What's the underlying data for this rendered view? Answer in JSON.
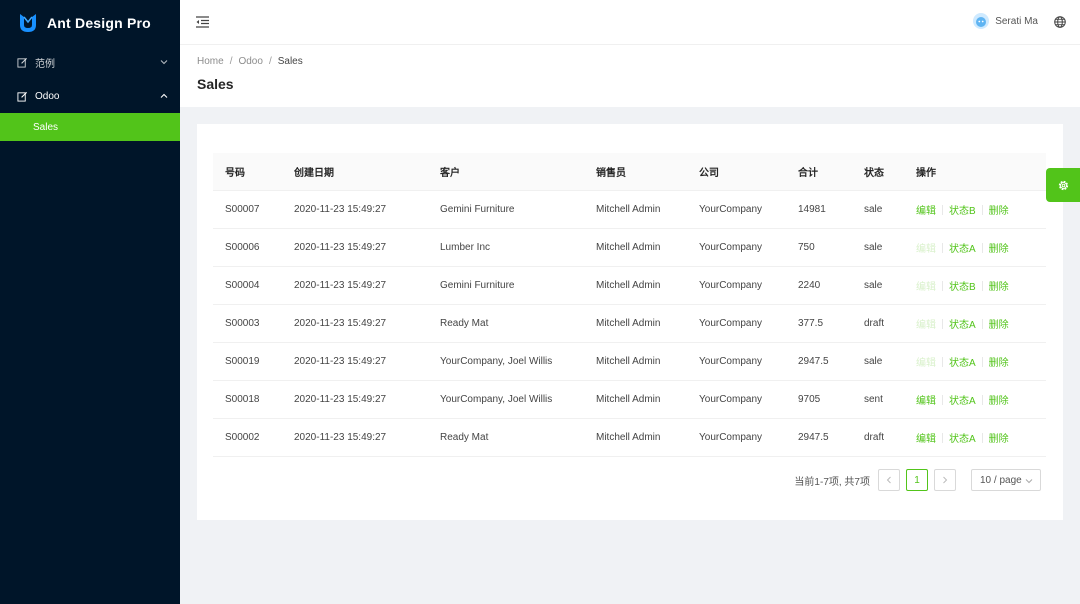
{
  "app": {
    "title": "Ant Design Pro"
  },
  "sidebar": {
    "menus": [
      {
        "label": "范例",
        "icon": "edit-icon",
        "expanded": false
      },
      {
        "label": "Odoo",
        "icon": "edit-icon",
        "expanded": true
      }
    ],
    "submenu": {
      "label": "Sales",
      "selected": true
    }
  },
  "header": {
    "user_name": "Serati Ma"
  },
  "breadcrumb": {
    "items": [
      "Home",
      "Odoo",
      "Sales"
    ]
  },
  "page": {
    "title": "Sales"
  },
  "table": {
    "columns": [
      "号码",
      "创建日期",
      "客户",
      "销售员",
      "公司",
      "合计",
      "状态",
      "操作"
    ],
    "rows": [
      {
        "id": "S00007",
        "date": "2020-11-23 15:49:27",
        "customer": "Gemini Furniture",
        "sales": "Mitchell Admin",
        "company": "YourCompany",
        "total": "14981",
        "state": "sale",
        "edit": "编辑",
        "edit_enabled": true,
        "toggle": "状态B",
        "delete": "删除"
      },
      {
        "id": "S00006",
        "date": "2020-11-23 15:49:27",
        "customer": "Lumber Inc",
        "sales": "Mitchell Admin",
        "company": "YourCompany",
        "total": "750",
        "state": "sale",
        "edit": "编辑",
        "edit_enabled": false,
        "toggle": "状态A",
        "delete": "删除"
      },
      {
        "id": "S00004",
        "date": "2020-11-23 15:49:27",
        "customer": "Gemini Furniture",
        "sales": "Mitchell Admin",
        "company": "YourCompany",
        "total": "2240",
        "state": "sale",
        "edit": "编辑",
        "edit_enabled": false,
        "toggle": "状态B",
        "delete": "删除"
      },
      {
        "id": "S00003",
        "date": "2020-11-23 15:49:27",
        "customer": "Ready Mat",
        "sales": "Mitchell Admin",
        "company": "YourCompany",
        "total": "377.5",
        "state": "draft",
        "edit": "编辑",
        "edit_enabled": false,
        "toggle": "状态A",
        "delete": "删除"
      },
      {
        "id": "S00019",
        "date": "2020-11-23 15:49:27",
        "customer": "YourCompany, Joel Willis",
        "sales": "Mitchell Admin",
        "company": "YourCompany",
        "total": "2947.5",
        "state": "sale",
        "edit": "编辑",
        "edit_enabled": false,
        "toggle": "状态A",
        "delete": "删除"
      },
      {
        "id": "S00018",
        "date": "2020-11-23 15:49:27",
        "customer": "YourCompany, Joel Willis",
        "sales": "Mitchell Admin",
        "company": "YourCompany",
        "total": "9705",
        "state": "sent",
        "edit": "编辑",
        "edit_enabled": true,
        "toggle": "状态A",
        "delete": "删除"
      },
      {
        "id": "S00002",
        "date": "2020-11-23 15:49:27",
        "customer": "Ready Mat",
        "sales": "Mitchell Admin",
        "company": "YourCompany",
        "total": "2947.5",
        "state": "draft",
        "edit": "编辑",
        "edit_enabled": true,
        "toggle": "状态A",
        "delete": "删除"
      }
    ]
  },
  "pagination": {
    "total_text": "当前1-7项, 共7项",
    "prev": "<",
    "next": ">",
    "current_page": "1",
    "page_size": "10 / page"
  },
  "colors": {
    "primary": "#52c41a",
    "sider_bg": "#001529"
  }
}
